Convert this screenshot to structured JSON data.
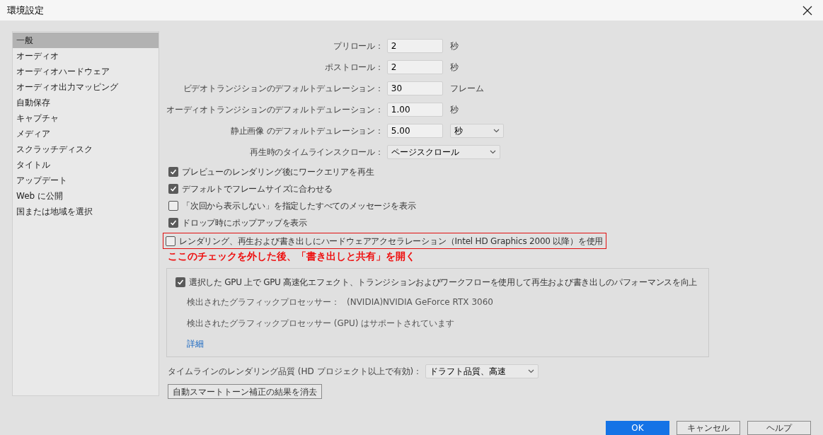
{
  "window": {
    "title": "環境設定"
  },
  "sidebar": {
    "items": [
      {
        "label": "一般",
        "selected": true
      },
      {
        "label": "オーディオ",
        "selected": false
      },
      {
        "label": "オーディオハードウェア",
        "selected": false
      },
      {
        "label": "オーディオ出力マッピング",
        "selected": false
      },
      {
        "label": "自動保存",
        "selected": false
      },
      {
        "label": "キャプチャ",
        "selected": false
      },
      {
        "label": "メディア",
        "selected": false
      },
      {
        "label": "スクラッチディスク",
        "selected": false
      },
      {
        "label": "タイトル",
        "selected": false
      },
      {
        "label": "アップデート",
        "selected": false
      },
      {
        "label": "Web に公開",
        "selected": false
      },
      {
        "label": "国または地域を選択",
        "selected": false
      }
    ]
  },
  "fields": [
    {
      "kind": "input",
      "label": "プリロール：",
      "value": "2",
      "unit": "秒"
    },
    {
      "kind": "input",
      "label": "ポストロール：",
      "value": "2",
      "unit": "秒"
    },
    {
      "kind": "input",
      "label": "ビデオトランジションのデフォルトデュレーション：",
      "value": "30",
      "unit": "フレーム"
    },
    {
      "kind": "input",
      "label": "オーディオトランジションのデフォルトデュレーション：",
      "value": "1.00",
      "unit": "秒"
    },
    {
      "kind": "input",
      "label": "静止画像 のデフォルトデュレーション：",
      "value": "5.00",
      "unit_select": "秒"
    },
    {
      "kind": "select",
      "label": "再生時のタイムラインスクロール：",
      "value": "ページスクロール"
    }
  ],
  "checkboxes": [
    {
      "label": "プレビューのレンダリング後にワークエリアを再生",
      "checked": true,
      "highlighted": false
    },
    {
      "label": "デフォルトでフレームサイズに合わせる",
      "checked": true,
      "highlighted": false
    },
    {
      "label": "「次回から表示しない」を指定したすべてのメッセージを表示",
      "checked": false,
      "highlighted": false
    },
    {
      "label": "ドロップ時にポップアップを表示",
      "checked": true,
      "highlighted": false
    },
    {
      "label": "レンダリング、再生および書き出しにハードウェアアクセラレーション（Intel HD Graphics 2000 以降）を使用",
      "checked": false,
      "highlighted": true
    }
  ],
  "annotation": "ここのチェックを外した後、「書き出しと共有」を開く",
  "gpu_group": {
    "checkbox": {
      "label": "選択した GPU 上で GPU 高速化エフェクト、トランジションおよびワークフローを使用して再生および書き出しのパフォーマンスを向上",
      "checked": true
    },
    "processor_label": "検出されたグラフィックプロセッサー：",
    "processor_value": "(NVIDIA)NVIDIA GeForce RTX 3060",
    "support_text": "検出されたグラフィックプロセッサー (GPU) はサポートされています",
    "details_link": "詳細"
  },
  "render_quality": {
    "label": "タイムラインのレンダリング品質 (HD プロジェクト以上で有効)：",
    "value": "ドラフト品質、高速"
  },
  "clear_button": "自動スマートトーン補正の結果を消去",
  "dialog_buttons": [
    {
      "label": "OK",
      "default": true
    },
    {
      "label": "キャンセル",
      "default": false
    },
    {
      "label": "ヘルプ",
      "default": false
    }
  ]
}
